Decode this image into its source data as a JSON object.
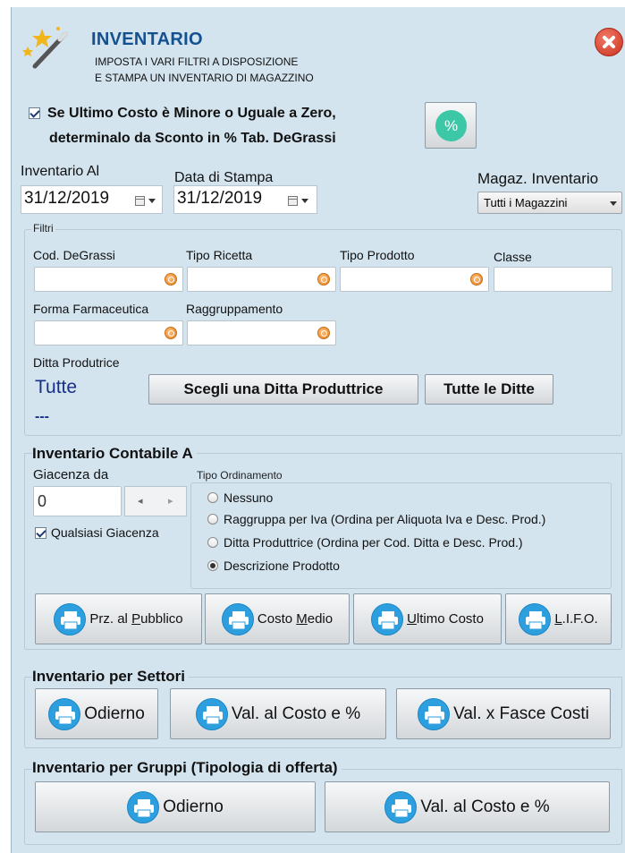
{
  "header": {
    "title": "INVENTARIO",
    "subtitle_line1": "IMPOSTA I VARI FILTRI A DISPOSIZIONE",
    "subtitle_line2": "E STAMPA UN INVENTARIO DI MAGAZZINO",
    "close_icon": "close-icon",
    "logo_icon": "magic-wand-icon"
  },
  "options": {
    "ultimo_costo_checked": true,
    "ultimo_costo_line1": "Se Ultimo Costo è Minore o Uguale a Zero,",
    "ultimo_costo_line2": "determinalo da Sconto in % Tab. DeGrassi",
    "percent_button_label": "%"
  },
  "dates": {
    "inventario_al_label": "Inventario Al",
    "inventario_al_value": "31/12/2019",
    "data_stampa_label": "Data di Stampa",
    "data_stampa_value": "31/12/2019",
    "magazzino_label": "Magaz. Inventario",
    "magazzino_value": "Tutti i Magazzini"
  },
  "filtri": {
    "legend": "Filtri",
    "cod_degrassi_label": "Cod. DeGrassi",
    "tipo_ricetta_label": "Tipo Ricetta",
    "tipo_prodotto_label": "Tipo Prodotto",
    "classe_label": "Classe",
    "forma_farmaceutica_label": "Forma Farmaceutica",
    "raggruppamento_label": "Raggruppamento",
    "ditta_label": "Ditta Produtrice",
    "ditta_value": "Tutte",
    "ditta_code": "---",
    "scegli_ditta_button": "Scegli una Ditta Produttrice",
    "tutte_ditte_button": "Tutte le Ditte"
  },
  "contabile": {
    "heading": "Inventario Contabile A",
    "giacenza_label": "Giacenza da",
    "giacenza_value": "0",
    "qualsiasi_label": "Qualsiasi Giacenza",
    "qualsiasi_checked": true,
    "ordinamento_legend": "Tipo Ordinamento",
    "ordinamento_options": [
      {
        "label": "Nessuno",
        "selected": false
      },
      {
        "label": "Raggruppa per Iva (Ordina per Aliquota Iva e Desc. Prod.)",
        "selected": false
      },
      {
        "label": "Ditta Produttrice (Ordina per Cod. Ditta e Desc. Prod.)",
        "selected": false
      },
      {
        "label": "Descrizione Prodotto",
        "selected": true
      }
    ],
    "buttons": {
      "prezzo_pre": "Prz. al ",
      "prezzo_u": "P",
      "prezzo_post": "ubblico",
      "medio_pre": "Costo ",
      "medio_u": "M",
      "medio_post": "edio",
      "ultimo_u": "U",
      "ultimo_post": "ltimo Costo",
      "lifo_u": "L",
      "lifo_post": ".I.F.O."
    }
  },
  "settori": {
    "heading": "Inventario per Settori",
    "odierno": "Odierno",
    "val_costo": "Val. al Costo e %",
    "val_fasce": "Val. x Fasce Costi"
  },
  "gruppi": {
    "heading": "Inventario per Gruppi (Tipologia di offerta)",
    "odierno": "Odierno",
    "val_costo": "Val. al Costo e %"
  },
  "colors": {
    "panel_bg": "#d3e4ef",
    "title_blue": "#15508f",
    "printer_blue": "#2d9ede",
    "percent_green": "#3cc7a6",
    "close_red": "#d9432f"
  }
}
